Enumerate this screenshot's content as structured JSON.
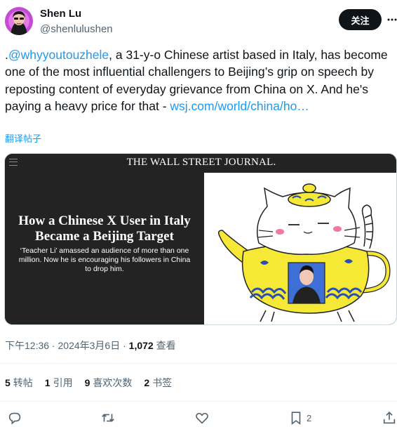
{
  "author": {
    "name": "Shen Lu",
    "handle": "@shenlulushen",
    "follow_label": "关注"
  },
  "tweet": {
    "prefix": ".",
    "mention": "@whyyoutouzhele",
    "body": ", a 31-y-o Chinese artist based in Italy, has become one of the most influential challengers to Beijing’s grip on speech by reposting content of everyday grievance from China on X. And he's paying a heavy price for that - ",
    "link_text": "wsj.com/world/china/ho…",
    "translate_label": "翻译帖子"
  },
  "card": {
    "masthead": "THE WALL STREET JOURNAL.",
    "headline": "How a Chinese X User in Italy Became a Beijing Target",
    "dek": "‘Teacher Li’ amassed an audience of more than one million. Now he is encouraging his followers in China to drop him."
  },
  "meta": {
    "time": "下午12:36",
    "sep": " · ",
    "date": "2024年3月6日",
    "views_count": "1,072",
    "views_label": " 查看"
  },
  "stats": [
    {
      "count": "5",
      "label": "转帖"
    },
    {
      "count": "1",
      "label": "引用"
    },
    {
      "count": "9",
      "label": "喜欢次数"
    },
    {
      "count": "2",
      "label": "书签"
    }
  ],
  "actions": {
    "bookmark_count": "2"
  },
  "colors": {
    "accent": "#1d9bf0",
    "text": "#0f1419",
    "secondary": "#536471",
    "teapot_yellow": "#f5e936",
    "teapot_blue": "#2a4fb0"
  },
  "icons": [
    "more-icon",
    "menu-icon",
    "reply-icon",
    "retweet-icon",
    "like-icon",
    "bookmark-icon",
    "share-icon"
  ]
}
